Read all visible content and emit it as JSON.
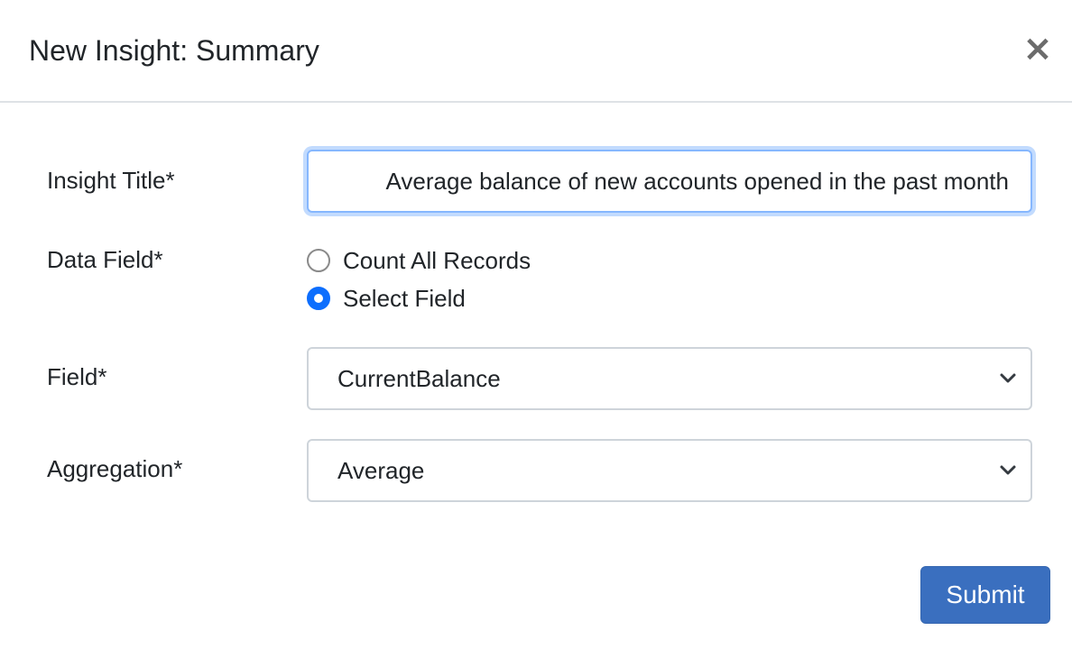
{
  "header": {
    "title": "New Insight: Summary",
    "close_label": "×"
  },
  "form": {
    "insight_title": {
      "label": "Insight Title*",
      "value": "Average balance of new accounts opened in the past month"
    },
    "data_field": {
      "label": "Data Field*",
      "options": [
        {
          "label": "Count All Records",
          "checked": false
        },
        {
          "label": "Select Field",
          "checked": true
        }
      ]
    },
    "field": {
      "label": "Field*",
      "selected": "CurrentBalance"
    },
    "aggregation": {
      "label": "Aggregation*",
      "selected": "Average"
    }
  },
  "footer": {
    "submit_label": "Submit"
  },
  "icons": {
    "close": "close-icon",
    "select_arrow": "chevron-down-icon",
    "radio": "radio-button"
  },
  "colors": {
    "primary": "#3a6fbf",
    "radio_checked": "#0d6efd",
    "focus_border": "#86b7fe",
    "border": "#ced4da"
  }
}
